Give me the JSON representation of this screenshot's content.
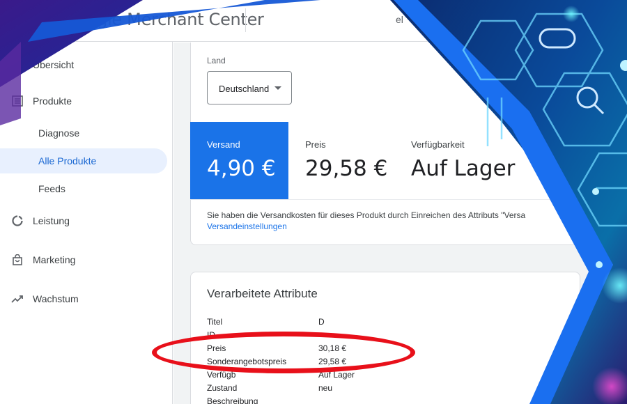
{
  "header": {
    "app_title": "Google Merchant Center",
    "fragment": "el"
  },
  "sidebar": {
    "items": [
      {
        "label": "Übersicht",
        "icon": "overview-icon"
      },
      {
        "label": "Produkte",
        "icon": "list-icon"
      },
      {
        "label": "Diagnose"
      },
      {
        "label": "Alle Produkte",
        "active": true
      },
      {
        "label": "Feeds"
      },
      {
        "label": "Leistung",
        "icon": "performance-icon"
      },
      {
        "label": "Marketing",
        "icon": "shopping-bag-icon"
      },
      {
        "label": "Wachstum",
        "icon": "trending-up-icon"
      }
    ]
  },
  "country": {
    "label": "Land",
    "value": "Deutschland"
  },
  "stats": {
    "shipping": {
      "label": "Versand",
      "value": "4,90 €"
    },
    "price": {
      "label": "Preis",
      "value": "29,58 €"
    },
    "availability": {
      "label": "Verfügbarkeit",
      "value": "Auf Lager"
    }
  },
  "shipping_note": {
    "text": "Sie haben die Versandkosten für dieses Produkt durch Einreichen des Attributs \"Versa",
    "link": "Versandeinstellungen"
  },
  "attributes": {
    "title": "Verarbeitete Attribute",
    "rows": [
      {
        "key": "Titel",
        "value": "D"
      },
      {
        "key": "ID",
        "value": ""
      },
      {
        "key": "Preis",
        "value": "30,18 €"
      },
      {
        "key": "Sonderangebotspreis",
        "value": "29,58 €"
      },
      {
        "key": "Verfügb",
        "value": "Auf Lager"
      },
      {
        "key": "Zustand",
        "value": "neu"
      },
      {
        "key": "Beschreibung",
        "value": ""
      }
    ]
  },
  "colors": {
    "accent": "#1a73e8",
    "annotation": "#e8101a"
  }
}
